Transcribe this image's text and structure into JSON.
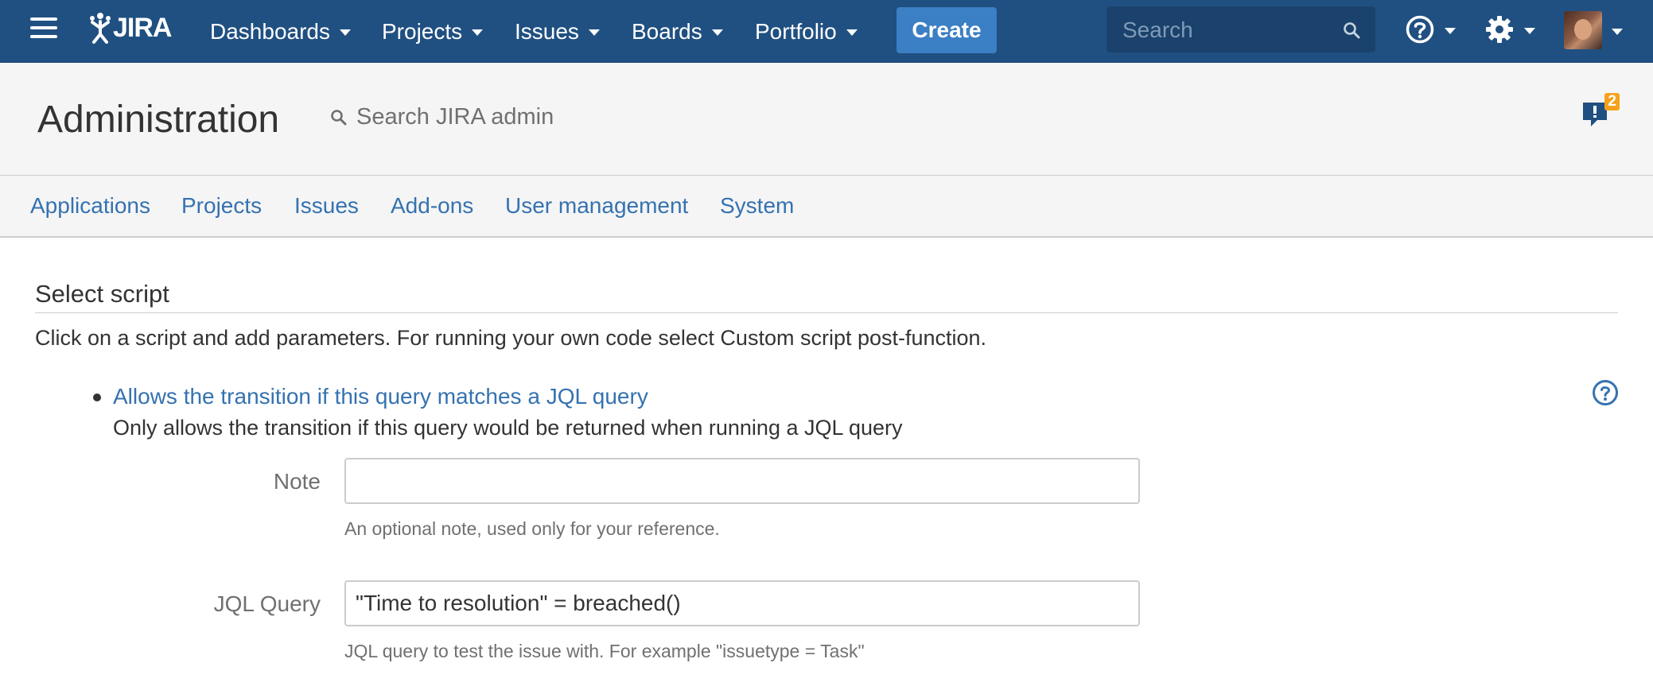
{
  "topnav": {
    "logo_text": "JIRA",
    "menus": [
      "Dashboards",
      "Projects",
      "Issues",
      "Boards",
      "Portfolio"
    ],
    "create_label": "Create",
    "search_placeholder": "Search"
  },
  "admin_header": {
    "title": "Administration",
    "search_placeholder": "Search JIRA admin",
    "notification_count": "2"
  },
  "admin_tabs": [
    "Applications",
    "Projects",
    "Issues",
    "Add-ons",
    "User management",
    "System"
  ],
  "content": {
    "section_title": "Select script",
    "intro": "Click on a script and add parameters. For running your own code select Custom script post-function.",
    "script": {
      "title": "Allows the transition if this query matches a JQL query",
      "description": "Only allows the transition if this query would be returned when running a JQL query"
    },
    "fields": {
      "note": {
        "label": "Note",
        "value": "",
        "help": "An optional note, used only for your reference."
      },
      "jql": {
        "label": "JQL Query",
        "value": "\"Time to resolution\" = breached()",
        "help": "JQL query to test the issue with. For example \"issuetype = Task\""
      }
    }
  },
  "colors": {
    "nav_bg": "#205081",
    "create_bg": "#3b7fc4",
    "link": "#3572b0",
    "badge": "#f6a21c"
  }
}
